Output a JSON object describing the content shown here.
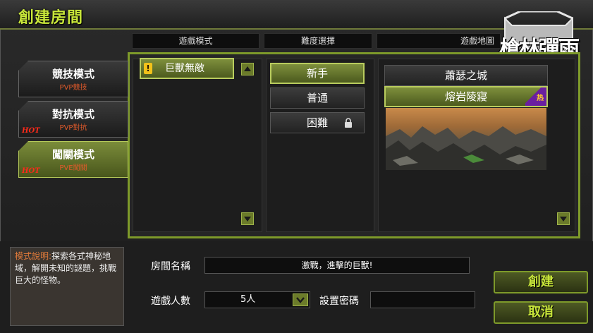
{
  "window": {
    "title": "創建房間"
  },
  "logo": {
    "text": "槍林彈雨"
  },
  "columns": {
    "mode": "遊戲模式",
    "difficulty": "難度選擇",
    "map": "遊戲地圖"
  },
  "mode_tabs": [
    {
      "name": "競技模式",
      "sub": "PVP競技",
      "hot": "",
      "active": false
    },
    {
      "name": "對抗模式",
      "sub": "PVP對抗",
      "hot": "HOT",
      "active": false
    },
    {
      "name": "闖關模式",
      "sub": "PVE闖關",
      "hot": "HOT",
      "active": true
    }
  ],
  "game_mode": {
    "selected": "巨獸無敵",
    "badge": "!"
  },
  "difficulty": [
    {
      "label": "新手",
      "selected": true
    },
    {
      "label": "普通",
      "selected": false
    },
    {
      "label": "困難",
      "selected": false,
      "locked": true
    }
  ],
  "maps": [
    {
      "label": "蕭瑟之城",
      "selected": false
    },
    {
      "label": "熔岩陵寢",
      "selected": true,
      "badge": "热"
    }
  ],
  "description": {
    "label": "模式說明:",
    "text": "探索各式神秘地域，解開未知的謎題，挑戰巨大的怪物。"
  },
  "form": {
    "room_name_label": "房間名稱",
    "room_name_value": "激戰，進擊的巨獸!",
    "players_label": "遊戲人數",
    "players_value": "5人",
    "password_label": "設置密碼",
    "password_value": ""
  },
  "buttons": {
    "create": "創建",
    "cancel": "取消"
  },
  "colors": {
    "accent": "#c8e63a",
    "border": "#7e9a2a",
    "hot": "#ff2a1a",
    "sub": "#e05a2b"
  }
}
